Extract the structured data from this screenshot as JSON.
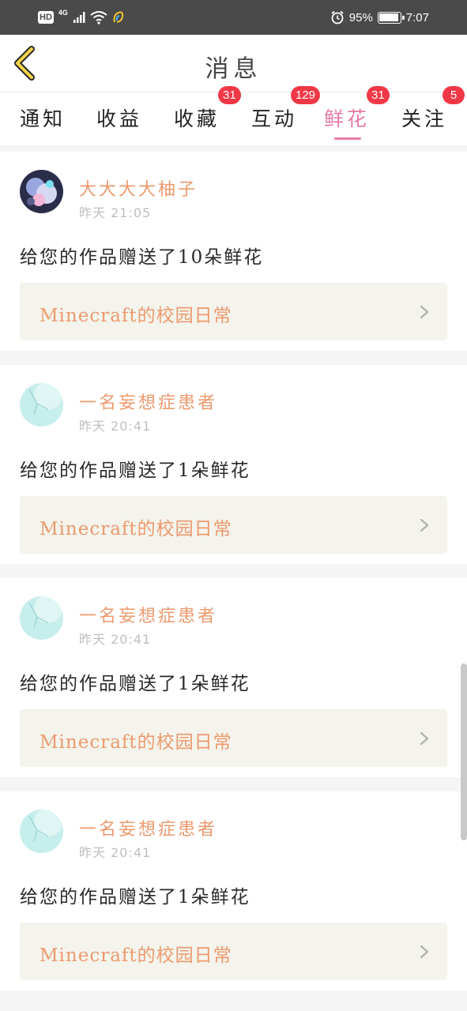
{
  "status_bar": {
    "hd": "HD",
    "network": "4G",
    "battery_percent": "95%",
    "battery_level": 0.95,
    "time": "7:07"
  },
  "header": {
    "title": "消息"
  },
  "tabs": [
    {
      "label": "通知",
      "badge": ""
    },
    {
      "label": "收益",
      "badge": ""
    },
    {
      "label": "收藏",
      "badge": "31"
    },
    {
      "label": "互动",
      "badge": "129"
    },
    {
      "label": "鲜花",
      "badge": "31",
      "active": true
    },
    {
      "label": "关注",
      "badge": "5"
    }
  ],
  "feed": [
    {
      "username": "大大大大柚子",
      "time": "昨天 21:05",
      "message": "给您的作品赠送了10朵鲜花",
      "work_title": "Minecraft的校园日常"
    },
    {
      "username": "一名妄想症患者",
      "time": "昨天 20:41",
      "message": "给您的作品赠送了1朵鲜花",
      "work_title": "Minecraft的校园日常"
    },
    {
      "username": "一名妄想症患者",
      "time": "昨天 20:41",
      "message": "给您的作品赠送了1朵鲜花",
      "work_title": "Minecraft的校园日常"
    },
    {
      "username": "一名妄想症患者",
      "time": "昨天 20:41",
      "message": "给您的作品赠送了1朵鲜花",
      "work_title": "Minecraft的校园日常"
    }
  ],
  "colors": {
    "accent": "#e87aa6",
    "username": "#ec9a6e",
    "badge": "#f03846",
    "link_bg": "#f4f3ec"
  },
  "icons": {
    "back": "chevron-left-icon",
    "link": "chevron-right-icon",
    "alarm": "alarm-icon",
    "wifi": "wifi-icon",
    "signal": "signal-icon"
  }
}
